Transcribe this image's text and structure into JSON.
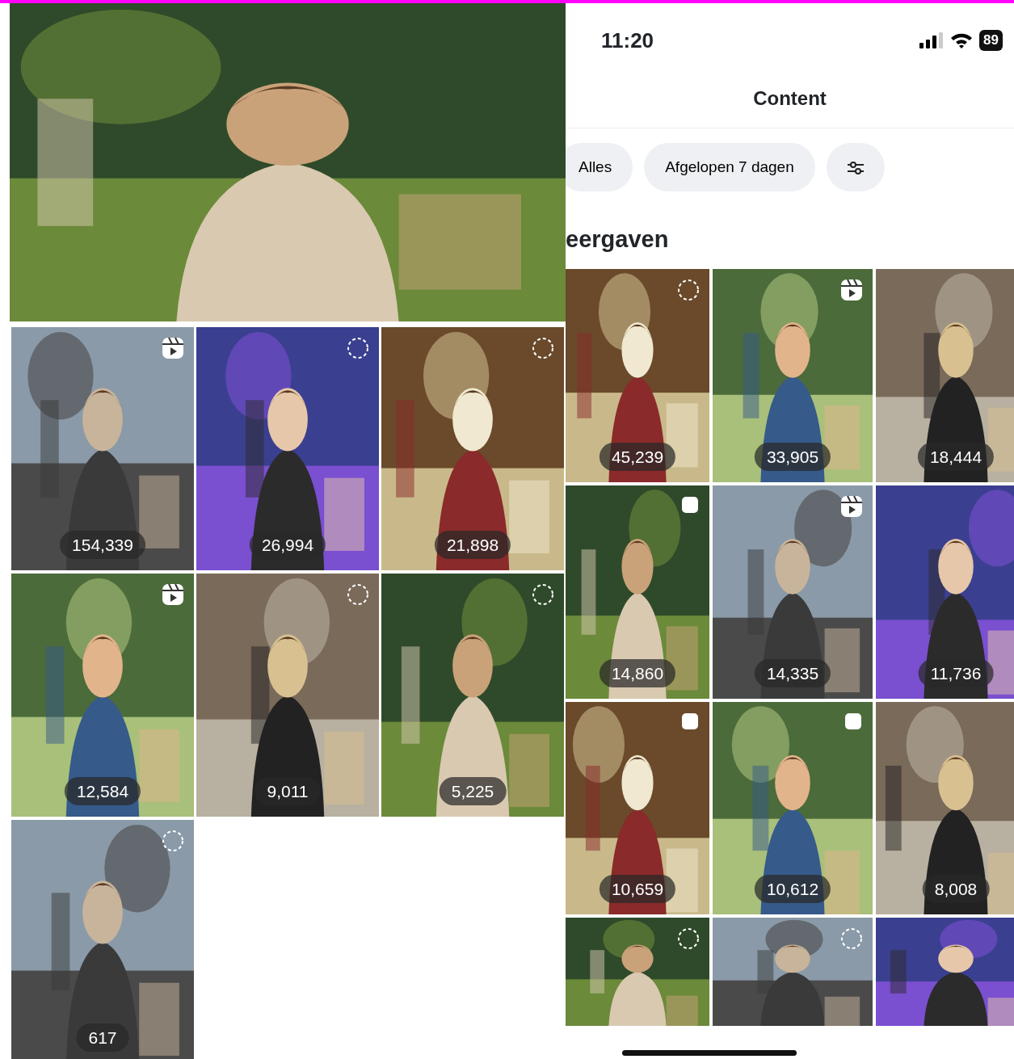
{
  "left_tiles": [
    {
      "views": "154,339",
      "kind": "reel"
    },
    {
      "views": "26,994",
      "kind": "spinner"
    },
    {
      "views": "21,898",
      "kind": "spinner"
    },
    {
      "views": "12,584",
      "kind": "reel"
    },
    {
      "views": "9,011",
      "kind": "spinner"
    },
    {
      "views": "5,225",
      "kind": "spinner"
    },
    {
      "views": "617",
      "kind": "spinner"
    }
  ],
  "status_bar": {
    "time": "11:20",
    "battery": "89"
  },
  "title": "Content",
  "filters": [
    {
      "label": "Alles"
    },
    {
      "label": "Afgelopen 7 dagen"
    }
  ],
  "heading": "eergaven",
  "tiles": [
    {
      "views": "45,239",
      "kind": "spinner"
    },
    {
      "views": "33,905",
      "kind": "reel"
    },
    {
      "views": "18,444",
      "kind": "plain"
    },
    {
      "views": "14,860",
      "kind": "square"
    },
    {
      "views": "14,335",
      "kind": "reel"
    },
    {
      "views": "11,736",
      "kind": "plain"
    },
    {
      "views": "10,659",
      "kind": "square"
    },
    {
      "views": "10,612",
      "kind": "square"
    },
    {
      "views": "8,008",
      "kind": "plain"
    },
    {
      "kind": "spinner"
    },
    {
      "kind": "spinner"
    },
    {
      "kind": "plain"
    }
  ]
}
